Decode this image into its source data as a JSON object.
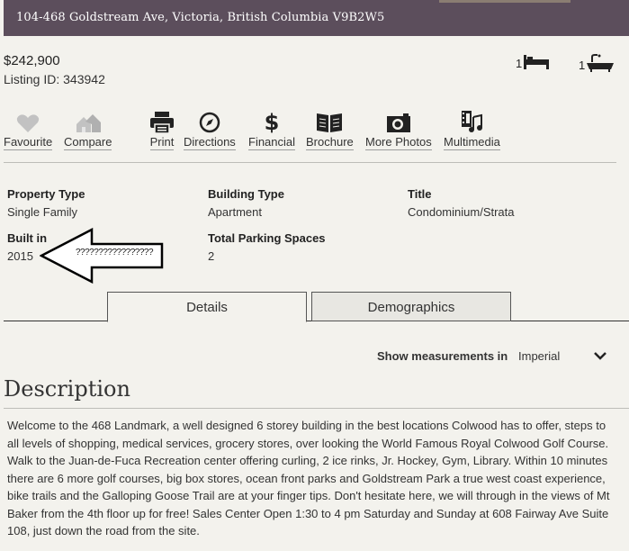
{
  "header": {
    "address": "104-468 Goldstream Ave, Victoria, British Columbia   V9B2W5"
  },
  "summary": {
    "price": "$242,900",
    "listing_id": "Listing ID: 343942",
    "bedrooms": "1",
    "bathrooms": "1"
  },
  "actions": [
    {
      "label": "Favourite",
      "icon": "heart-icon"
    },
    {
      "label": "Compare",
      "icon": "houses-icon"
    },
    {
      "label": "Print",
      "icon": "printer-icon"
    },
    {
      "label": "Directions",
      "icon": "compass-icon"
    },
    {
      "label": "Financial",
      "icon": "dollar-icon"
    },
    {
      "label": "Brochure",
      "icon": "book-icon"
    },
    {
      "label": "More Photos",
      "icon": "camera-icon"
    },
    {
      "label": "Multimedia",
      "icon": "film-music-icon"
    }
  ],
  "properties": {
    "property_type": {
      "key": "Property Type",
      "value": "Single Family"
    },
    "building_type": {
      "key": "Building Type",
      "value": "Apartment"
    },
    "title": {
      "key": "Title",
      "value": "Condominium/Strata"
    },
    "built_in": {
      "key": "Built in",
      "value": "2015"
    },
    "parking": {
      "key": "Total Parking Spaces",
      "value": "2"
    }
  },
  "annotation": {
    "text": "?????????????????",
    "icon": "left-arrow-icon"
  },
  "tabs": [
    {
      "label": "Details",
      "active": true
    },
    {
      "label": "Demographics",
      "active": false
    }
  ],
  "measurements": {
    "label": "Show measurements in",
    "value": "Imperial"
  },
  "description": {
    "title": "Description",
    "text": "Welcome to the 468 Landmark, a well designed 6 storey building in the best locations Colwood has to offer, steps to all levels of shopping, medical services, grocery stores, over looking the World Famous Royal Colwood Golf Course. Walk to the Juan-de-Fuca Recreation center offering curling, 2 ice rinks, Jr. Hockey, Gym, Library. Within 10 minutes there are 6 more golf courses, big box stores, ocean front parks and Goldstream Park a true west coast experience, bike trails and the Galloping Goose Trail are at your finger tips. Don't hesitate here, we will through in the views of Mt Baker from the 4th floor up for free! Sales Center Open 1:30 to 4 pm Saturday and Sunday at 608 Fairway Ave Suite 108, just down the road from the site."
  },
  "colors": {
    "header_bg": "#5c4e5c",
    "page_bg": "#f3f2ed",
    "icon_dark": "#222222",
    "icon_muted": "#bdbdbd"
  }
}
